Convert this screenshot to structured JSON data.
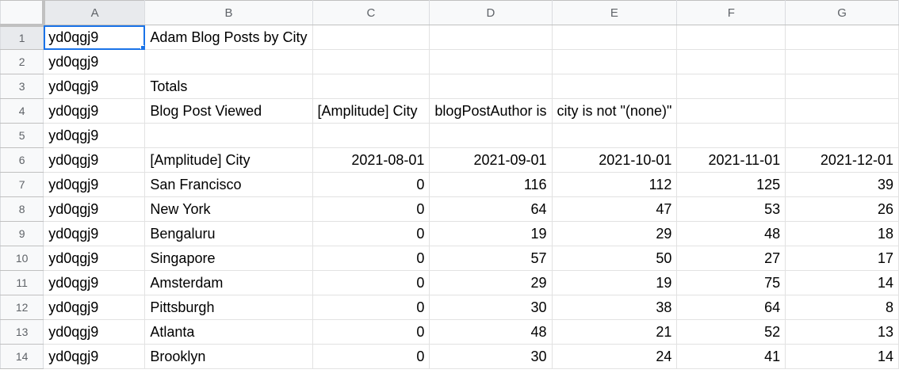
{
  "columns": [
    "A",
    "B",
    "C",
    "D",
    "E",
    "F",
    "G"
  ],
  "rows": [
    [
      "yd0qgj9",
      "Adam Blog Posts by City",
      "",
      "",
      "",
      "",
      ""
    ],
    [
      "yd0qgj9",
      "",
      "",
      "",
      "",
      "",
      ""
    ],
    [
      "yd0qgj9",
      "Totals",
      "",
      "",
      "",
      "",
      ""
    ],
    [
      "yd0qgj9",
      "Blog Post Viewed",
      "[Amplitude] City",
      "blogPostAuthor is",
      "city is not \"(none)\"",
      "",
      ""
    ],
    [
      "yd0qgj9",
      "",
      "",
      "",
      "",
      "",
      ""
    ],
    [
      "yd0qgj9",
      "[Amplitude] City",
      "2021-08-01",
      "2021-09-01",
      "2021-10-01",
      "2021-11-01",
      "2021-12-01"
    ],
    [
      "yd0qgj9",
      "San Francisco",
      "0",
      "116",
      "112",
      "125",
      "39"
    ],
    [
      "yd0qgj9",
      "New York",
      "0",
      "64",
      "47",
      "53",
      "26"
    ],
    [
      "yd0qgj9",
      "Bengaluru",
      "0",
      "19",
      "29",
      "48",
      "18"
    ],
    [
      "yd0qgj9",
      "Singapore",
      "0",
      "57",
      "50",
      "27",
      "17"
    ],
    [
      "yd0qgj9",
      "Amsterdam",
      "0",
      "29",
      "19",
      "75",
      "14"
    ],
    [
      "yd0qgj9",
      "Pittsburgh",
      "0",
      "30",
      "38",
      "64",
      "8"
    ],
    [
      "yd0qgj9",
      "Atlanta",
      "0",
      "48",
      "21",
      "52",
      "13"
    ],
    [
      "yd0qgj9",
      "Brooklyn",
      "0",
      "30",
      "24",
      "41",
      "14"
    ]
  ],
  "selected_cell": "A1",
  "colors": {
    "selection": "#1a73e8"
  }
}
